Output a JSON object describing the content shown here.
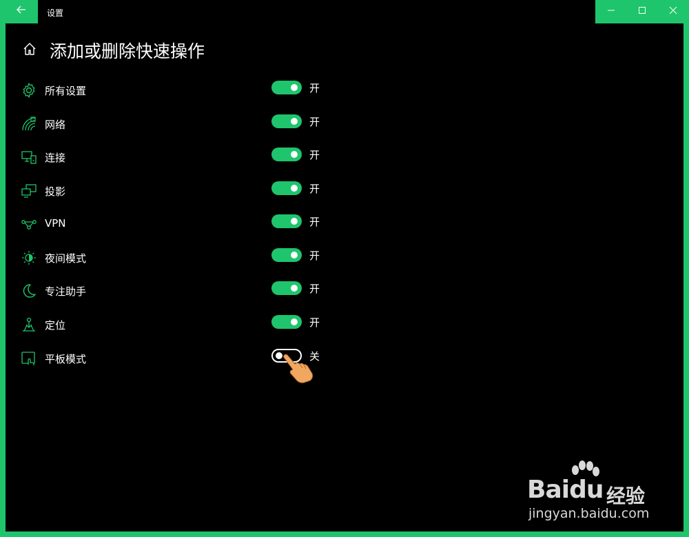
{
  "window": {
    "title": "设置",
    "back_icon": "back-arrow-icon",
    "controls": [
      "minimize",
      "maximize",
      "close"
    ]
  },
  "page": {
    "title": "添加或删除快速操作"
  },
  "items": [
    {
      "label": "所有设置",
      "icon": "gear-icon",
      "on": true,
      "state": "开"
    },
    {
      "label": "网络",
      "icon": "network-icon",
      "on": true,
      "state": "开"
    },
    {
      "label": "连接",
      "icon": "connect-icon",
      "on": true,
      "state": "开"
    },
    {
      "label": "投影",
      "icon": "project-icon",
      "on": true,
      "state": "开"
    },
    {
      "label": "VPN",
      "icon": "vpn-icon",
      "on": true,
      "state": "开"
    },
    {
      "label": "夜间模式",
      "icon": "night-light-icon",
      "on": true,
      "state": "开"
    },
    {
      "label": "专注助手",
      "icon": "moon-icon",
      "on": true,
      "state": "开"
    },
    {
      "label": "定位",
      "icon": "location-icon",
      "on": true,
      "state": "开"
    },
    {
      "label": "平板模式",
      "icon": "tablet-mode-icon",
      "on": false,
      "state": "关"
    }
  ],
  "watermark": {
    "brand": "Bai",
    "brand_suffix": "du",
    "cn": "经验",
    "url": "jingyan.baidu.com"
  },
  "colors": {
    "accent": "#1ec56c",
    "background": "#000000",
    "text": "#ffffff"
  }
}
